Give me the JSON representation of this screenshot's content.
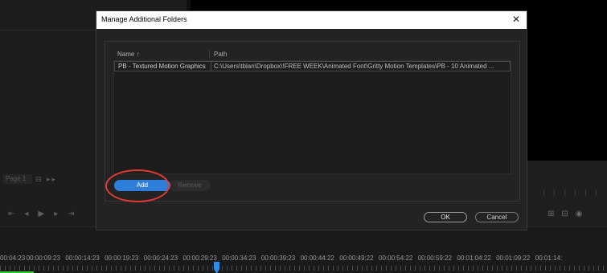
{
  "dialog": {
    "title": "Manage Additional Folders",
    "close_icon": "close-icon",
    "columns": {
      "name": "Name ↑",
      "path": "Path"
    },
    "rows": [
      {
        "name": "PB - Textured Motion Graphics",
        "path": "C:\\Users\\tblan\\Dropbox\\!FREE WEEK\\Animated Font\\Gritty Motion Templates\\PB - 10 Animated ..."
      }
    ],
    "buttons": {
      "add": "Add",
      "remove": "Remove",
      "ok": "OK",
      "cancel": "Cancel"
    },
    "accent_color": "#2d7fd9",
    "annotation_color": "#e23b33"
  },
  "background": {
    "page_select": "Page 1",
    "timeline_labels": [
      "00:04:23",
      "00:00:09:23",
      "00:00:14:23",
      "00:00:19:23",
      "00:00:24:23",
      "00:00:29:23",
      "00:00:34:23",
      "00:00:39:23",
      "00:00:44:22",
      "00:00:49:22",
      "00:00:54:22",
      "00:00:59:22",
      "00:01:04:22",
      "00:01:09:22",
      "00:01:14:"
    ],
    "playhead_color": "#2d8ceb"
  }
}
